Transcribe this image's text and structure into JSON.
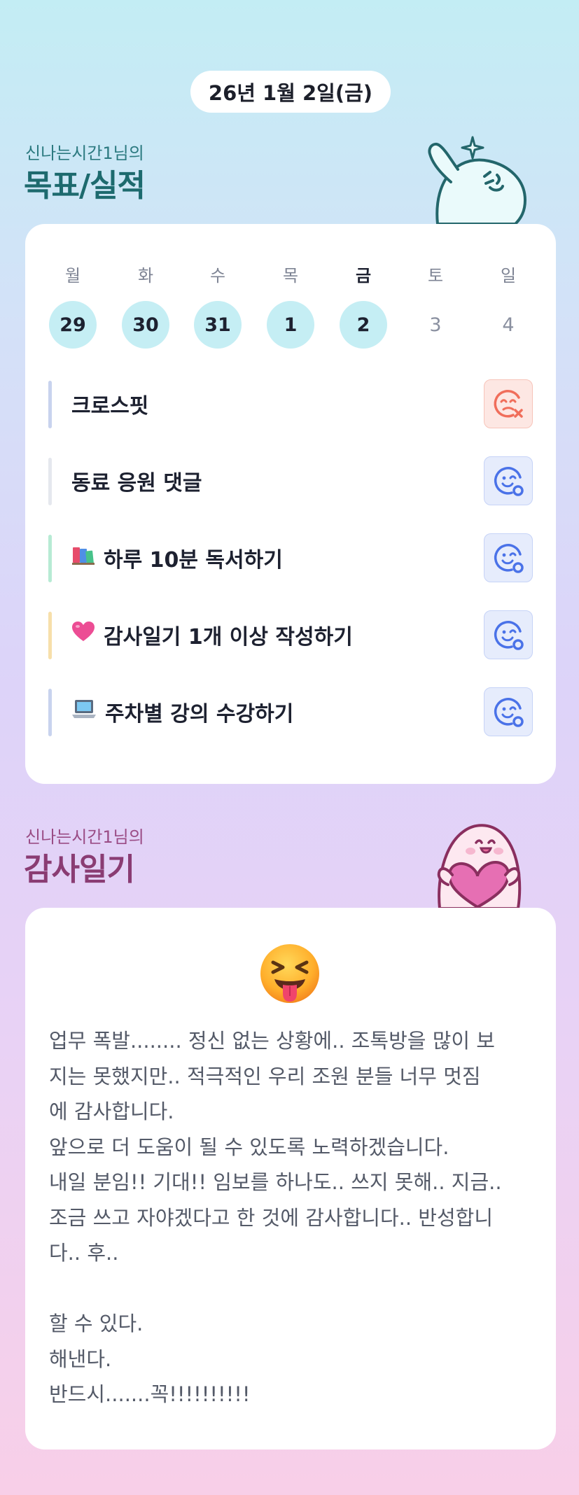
{
  "date": "26년 1월 2일(금)",
  "goals_section": {
    "owner": "신나는시간1님의",
    "title": "목표/실적",
    "title_color": "#1d6a6e",
    "weekdays": [
      "월",
      "화",
      "수",
      "목",
      "금",
      "토",
      "일"
    ],
    "days": [
      "29",
      "30",
      "31",
      "1",
      "2",
      "3",
      "4"
    ],
    "done_days": 5,
    "today_index": 4,
    "goals": [
      {
        "label": "크로스핏",
        "emoji": "",
        "status": "fail",
        "bar": "#c8d3ee"
      },
      {
        "label": "동료 응원 댓글",
        "emoji": "",
        "status": "ok",
        "bar": "#e5e8ee"
      },
      {
        "label": "하루 10분 독서하기",
        "emoji": "books-emoji",
        "status": "ok",
        "bar": "#b7ebd4"
      },
      {
        "label": "감사일기 1개 이상 작성하기",
        "emoji": "heart-emoji",
        "status": "ok",
        "bar": "#f7dfaa"
      },
      {
        "label": "주차별 강의 수강하기",
        "emoji": "laptop-emoji",
        "status": "ok",
        "bar": "#c8d3ee"
      }
    ]
  },
  "diary_section": {
    "owner": "신나는시간1님의",
    "title": "감사일기",
    "title_color": "#8a3c73",
    "emoji": "squinting-tongue-face",
    "text": "업무 폭발........ 정신 없는 상황에.. 조톡방을 많이 보\n지는 못했지만.. 적극적인 우리 조원 분들 너무 멋짐\n에 감사합니다.\n앞으로 더 도움이 될 수 있도록 노력하겠습니다.\n내일 분임!! 기대!! 임보를 하나도.. 쓰지 못해.. 지금..\n조금 쓰고 자야겠다고 한 것에 감사합니다.. 반성합니\n다.. 후..\n\n할 수 있다.\n해낸다.\n반드시.......꼭!!!!!!!!!!"
  },
  "colors": {
    "accent_teal": "#1d6a6e",
    "accent_plum": "#8a3c73",
    "done_day": "#c5eef4",
    "status_fail": "#f06e5b",
    "status_ok": "#4a72e8"
  }
}
